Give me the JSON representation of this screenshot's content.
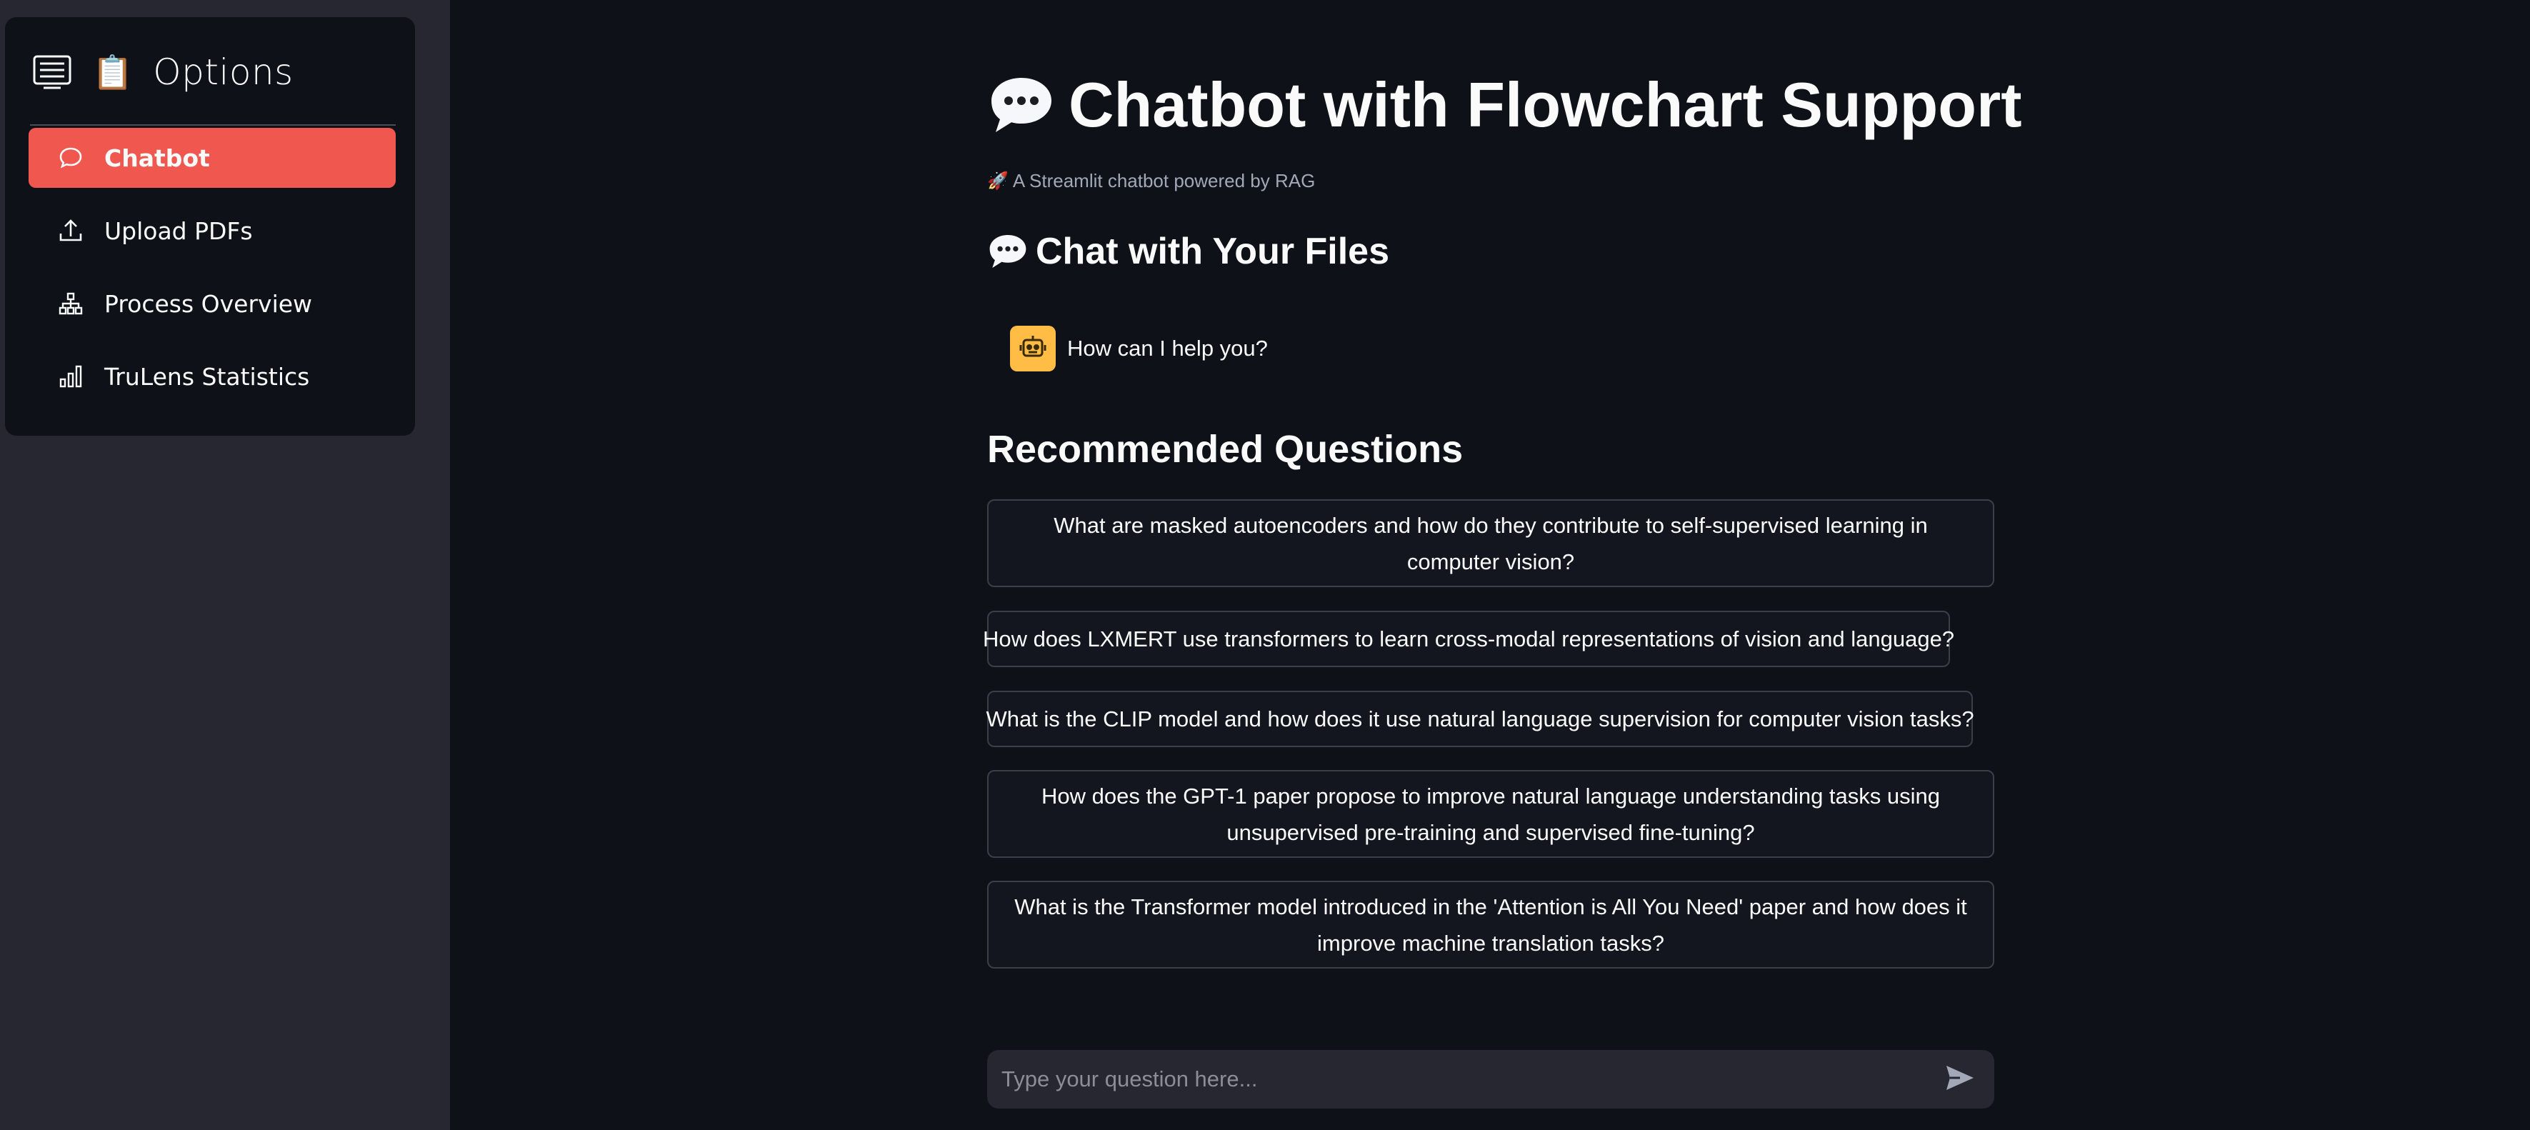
{
  "sidebar": {
    "header": {
      "icon": "list-icon",
      "emoji": "📋",
      "title": "Options"
    },
    "items": [
      {
        "label": "Chatbot",
        "icon": "chat-bubble-icon",
        "active": true
      },
      {
        "label": "Upload PDFs",
        "icon": "upload-icon",
        "active": false
      },
      {
        "label": "Process Overview",
        "icon": "diagram-icon",
        "active": false
      },
      {
        "label": "TruLens Statistics",
        "icon": "bar-chart-icon",
        "active": false
      }
    ]
  },
  "main": {
    "title_emoji": "💬",
    "title": "Chatbot with Flowchart Support",
    "caption_emoji": "🚀",
    "caption": "A Streamlit chatbot powered by RAG",
    "chat_section_emoji": "💬",
    "chat_section_title": "Chat with Your Files",
    "assistant_message": "How can I help you?",
    "recommended_title": "Recommended Questions",
    "questions": [
      "What are masked autoencoders and how do they contribute to self-supervised learning in computer vision?",
      "How does LXMERT use transformers to learn cross-modal representations of vision and language?",
      "What is the CLIP model and how does it use natural language supervision for computer vision tasks?",
      "How does the GPT-1 paper propose to improve natural language understanding tasks using unsupervised pre-training and supervised fine-tuning?",
      "What is the Transformer model introduced in the 'Attention is All You Need' paper and how does it improve machine translation tasks?"
    ],
    "input_placeholder": "Type your question here..."
  },
  "colors": {
    "accent": "#f0574f",
    "background": "#0e1117",
    "sidebar": "#262730",
    "avatar": "#ffbd45"
  }
}
